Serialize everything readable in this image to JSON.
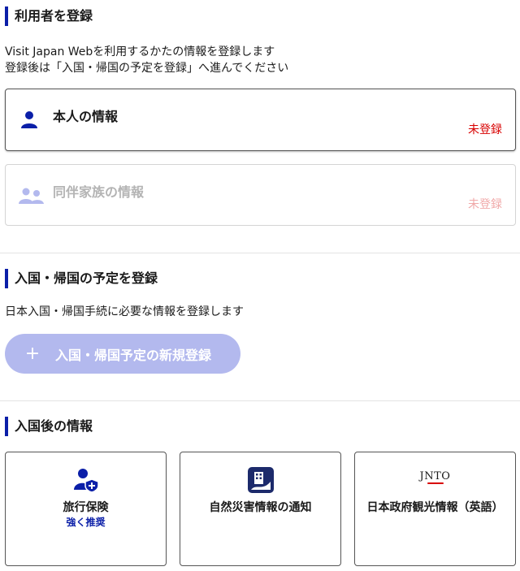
{
  "register_users": {
    "heading": "利用者を登録",
    "description_line1": "Visit Japan Webを利用するかたの情報を登録します",
    "description_line2": "登録後は「入国・帰国の予定を登録」へ進んでください",
    "self_card": {
      "title": "本人の情報",
      "status": "未登録",
      "icon": "person-icon"
    },
    "family_card": {
      "title": "同伴家族の情報",
      "status": "未登録",
      "icon": "group-icon"
    }
  },
  "register_schedule": {
    "heading": "入国・帰国の予定を登録",
    "description": "日本入国・帰国手続に必要な情報を登録します",
    "button_label": "入国・帰国予定の新規登録",
    "button_icon": "plus-icon"
  },
  "after_entry": {
    "heading": "入国後の情報",
    "tiles": [
      {
        "label": "旅行保険",
        "sublabel": "強く推奨",
        "icon": "insurance-icon"
      },
      {
        "label": "自然災害情報の通知",
        "icon": "disaster-app-icon"
      },
      {
        "label": "日本政府観光情報（英語）",
        "icon": "jnto-logo",
        "logo_text": "JNTO"
      }
    ]
  },
  "colors": {
    "accent": "#0b1fa8",
    "status_red": "#d80000",
    "button_disabled": "#b3b9ee"
  }
}
